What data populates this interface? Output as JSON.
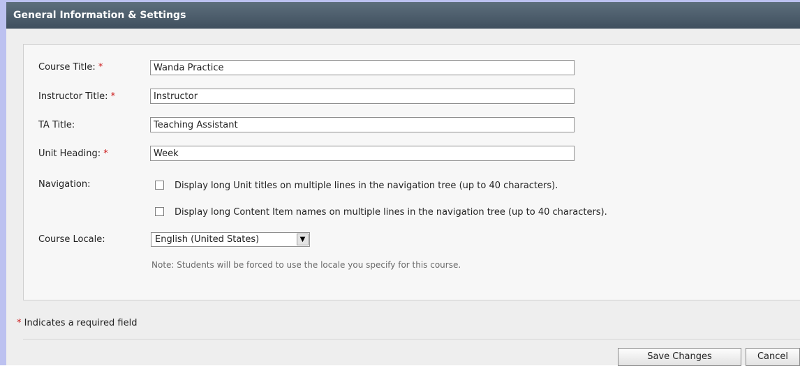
{
  "header": {
    "title": "General Information & Settings"
  },
  "fields": {
    "course_title": {
      "label": "Course Title:",
      "required_mark": "*",
      "value": "Wanda Practice"
    },
    "instructor_title": {
      "label": "Instructor Title:",
      "required_mark": "*",
      "value": "Instructor"
    },
    "ta_title": {
      "label": "TA Title:",
      "value": "Teaching Assistant"
    },
    "unit_heading": {
      "label": "Unit Heading:",
      "required_mark": "*",
      "value": "Week"
    }
  },
  "navigation": {
    "label": "Navigation:",
    "options": [
      {
        "label": "Display long Unit titles on multiple lines in the navigation tree (up to 40 characters).",
        "checked": false
      },
      {
        "label": "Display long Content Item names on multiple lines in the navigation tree (up to 40 characters).",
        "checked": false
      }
    ]
  },
  "locale": {
    "label": "Course Locale:",
    "selected": "English (United States)",
    "note": "Note: Students will be forced to use the locale you specify for this course."
  },
  "footer": {
    "required_mark": "*",
    "required_note": "Indicates a required field",
    "save_label": "Save Changes",
    "cancel_label": "Cancel"
  },
  "colors": {
    "titlebar": "#4a5a68",
    "required": "#cc1a1a",
    "outer_border": "#bcc1f0"
  }
}
